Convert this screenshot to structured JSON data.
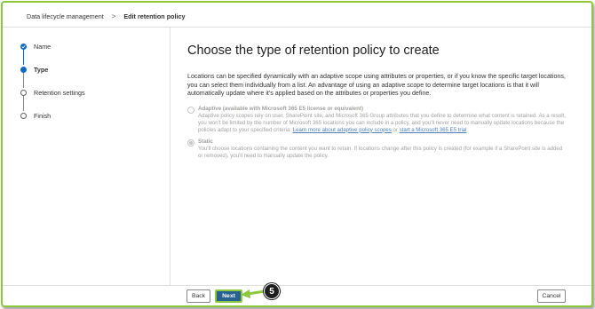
{
  "breadcrumb": {
    "parent": "Data lifecycle management",
    "separator": ">",
    "current": "Edit retention policy"
  },
  "steps": [
    {
      "label": "Name",
      "state": "complete"
    },
    {
      "label": "Type",
      "state": "current"
    },
    {
      "label": "Retention settings",
      "state": "pending"
    },
    {
      "label": "Finish",
      "state": "pending"
    }
  ],
  "main": {
    "title": "Choose the type of retention policy to create",
    "intro": "Locations can be specified dynamically with an adaptive scope using attributes or properties, or if you know the specific target locations, you can select them individually from a list. An advantage of using an adaptive scope to determine target locations is that it will automatically update where it's applied based on the attributes or properties you define.",
    "options": [
      {
        "title": "Adaptive (available with Microsoft 365 E5 license or equivalent)",
        "description": "Adaptive policy scopes rely on user, SharePoint site, and Microsoft 365 Group attributes that you define to determine what content is retained. As a result, you won't be limited by the number of Microsoft 365 locations you can include in a policy, and you'll never need to manually update locations because the policies adapt to your specified criteria.",
        "link1": "Learn more about adaptive policy scopes",
        "link_sep": "or",
        "link2": "start a Microsoft 365 E5 trial",
        "selected": false,
        "disabled": true
      },
      {
        "title": "Static",
        "description": "You'll choose locations containing the content you want to retain. If locations change after this policy is created (for example if a SharePoint site is added or removed), you'll need to manually update the policy.",
        "selected": true,
        "disabled": true
      }
    ]
  },
  "footer": {
    "back_label": "Back",
    "next_label": "Next",
    "cancel_label": "Cancel"
  },
  "callout": {
    "number": "5",
    "color": "#8dc63f"
  },
  "colors": {
    "accent": "#0f6cbd",
    "primary_button": "#28608f",
    "frame_border": "#8dc63f"
  }
}
